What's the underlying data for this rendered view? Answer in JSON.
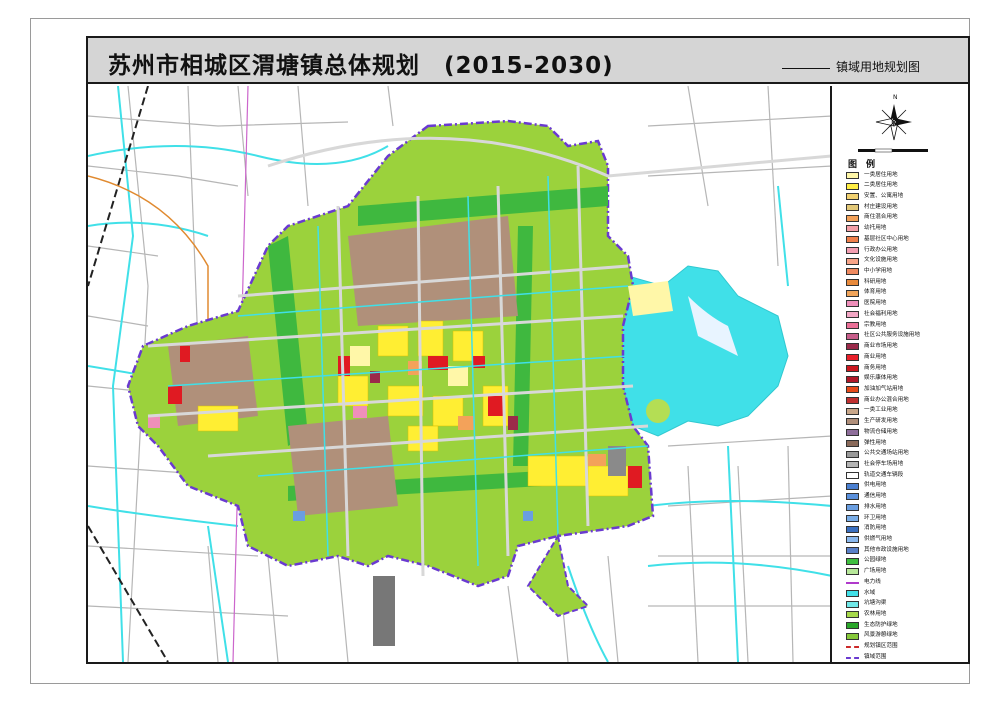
{
  "header": {
    "title": "苏州市相城区渭塘镇总体规划　(2015-2030)",
    "subtitle": "镇域用地规划图"
  },
  "legend": {
    "heading": "图　例",
    "north_label": "N",
    "items": [
      {
        "label": "一类居住用地",
        "color": "#fff7a8",
        "style": "fill"
      },
      {
        "label": "二类居住用地",
        "color": "#ffee44",
        "style": "fill"
      },
      {
        "label": "安置、公寓用地",
        "color": "#f0d070",
        "style": "fill"
      },
      {
        "label": "村庄建设用地",
        "color": "#e2c878",
        "style": "fill"
      },
      {
        "label": "商住混合用地",
        "color": "#f3a25a",
        "style": "fill"
      },
      {
        "label": "幼托用地",
        "color": "#f4a0a8",
        "style": "fill"
      },
      {
        "label": "基层社区中心用地",
        "color": "#ef7f4a",
        "style": "fill"
      },
      {
        "label": "行政办公用地",
        "color": "#f49fb2",
        "style": "fill"
      },
      {
        "label": "文化设施用地",
        "color": "#f7a488",
        "style": "fill"
      },
      {
        "label": "中小学用地",
        "color": "#ef8a60",
        "style": "fill"
      },
      {
        "label": "科研用地",
        "color": "#e88a3c",
        "style": "fill"
      },
      {
        "label": "体育用地",
        "color": "#f0a45a",
        "style": "fill"
      },
      {
        "label": "医院用地",
        "color": "#ef8fba",
        "style": "fill"
      },
      {
        "label": "社会福利用地",
        "color": "#f2a6c4",
        "style": "fill"
      },
      {
        "label": "宗教用地",
        "color": "#ea6f97",
        "style": "fill"
      },
      {
        "label": "社区公共服务设施用地",
        "color": "#c75d8a",
        "style": "fill"
      },
      {
        "label": "商业市场用地",
        "color": "#9b2a4a",
        "style": "fill"
      },
      {
        "label": "商业用地",
        "color": "#e8202a",
        "style": "fill"
      },
      {
        "label": "商务用地",
        "color": "#cc1820",
        "style": "fill"
      },
      {
        "label": "娱乐康体用地",
        "color": "#b01828",
        "style": "fill"
      },
      {
        "label": "加油加气站用地",
        "color": "#e64a1a",
        "style": "fill"
      },
      {
        "label": "商业办公混合用地",
        "color": "#c03030",
        "style": "fill"
      },
      {
        "label": "一类工业用地",
        "color": "#c9a78a",
        "style": "fill"
      },
      {
        "label": "生产研发用地",
        "color": "#b08f7a",
        "style": "fill"
      },
      {
        "label": "物流仓储用地",
        "color": "#8e6e9a",
        "style": "fill"
      },
      {
        "label": "弹性用地",
        "color": "#8a6a5a",
        "style": "fill"
      },
      {
        "label": "公共交通场站用地",
        "color": "#9a9a9a",
        "style": "fill"
      },
      {
        "label": "社会停车场用地",
        "color": "#b4b4b4",
        "style": "fill"
      },
      {
        "label": "轨道交通车辆段",
        "color": "#ffffff",
        "style": "fill"
      },
      {
        "label": "供电用地",
        "color": "#4a7fd0",
        "style": "fill"
      },
      {
        "label": "通信用地",
        "color": "#5a90dc",
        "style": "fill"
      },
      {
        "label": "排水用地",
        "color": "#6a9ee0",
        "style": "fill"
      },
      {
        "label": "环卫用地",
        "color": "#7aaee8",
        "style": "fill"
      },
      {
        "label": "消防用地",
        "color": "#3a6fc0",
        "style": "fill"
      },
      {
        "label": "供燃气用地",
        "color": "#8ab8ee",
        "style": "fill"
      },
      {
        "label": "其他市政设施用地",
        "color": "#5a80c8",
        "style": "fill"
      },
      {
        "label": "公园绿地",
        "color": "#3fbf3f",
        "style": "fill"
      },
      {
        "label": "广场用地",
        "color": "#b8e89a",
        "style": "fill"
      },
      {
        "label": "电力线",
        "color": "#b03acb",
        "style": "line"
      },
      {
        "label": "水域",
        "color": "#40e0e8",
        "style": "fill"
      },
      {
        "label": "坑塘沟渠",
        "color": "#70e8e8",
        "style": "fill"
      },
      {
        "label": "农林用地",
        "color": "#a6d84a",
        "style": "fill"
      },
      {
        "label": "生态防护绿地",
        "color": "#2aa62a",
        "style": "fill"
      },
      {
        "label": "风景游憩绿地",
        "color": "#86c83a",
        "style": "fill"
      },
      {
        "label": "规划镇区范围",
        "color": "#cc2a2a",
        "style": "dash"
      },
      {
        "label": "镇域范围",
        "color": "#6a3ad0",
        "style": "dash"
      }
    ]
  },
  "colors": {
    "agri": "#9bd23c",
    "agri_light": "#b4de54",
    "green": "#3fb83f",
    "industry": "#b0907a",
    "res2": "#ffee33",
    "res1": "#fff7a8",
    "commerce": "#e01a22",
    "water": "#40e0e8",
    "road": "#bdbdbd",
    "boundary": "#6a3ad0"
  }
}
